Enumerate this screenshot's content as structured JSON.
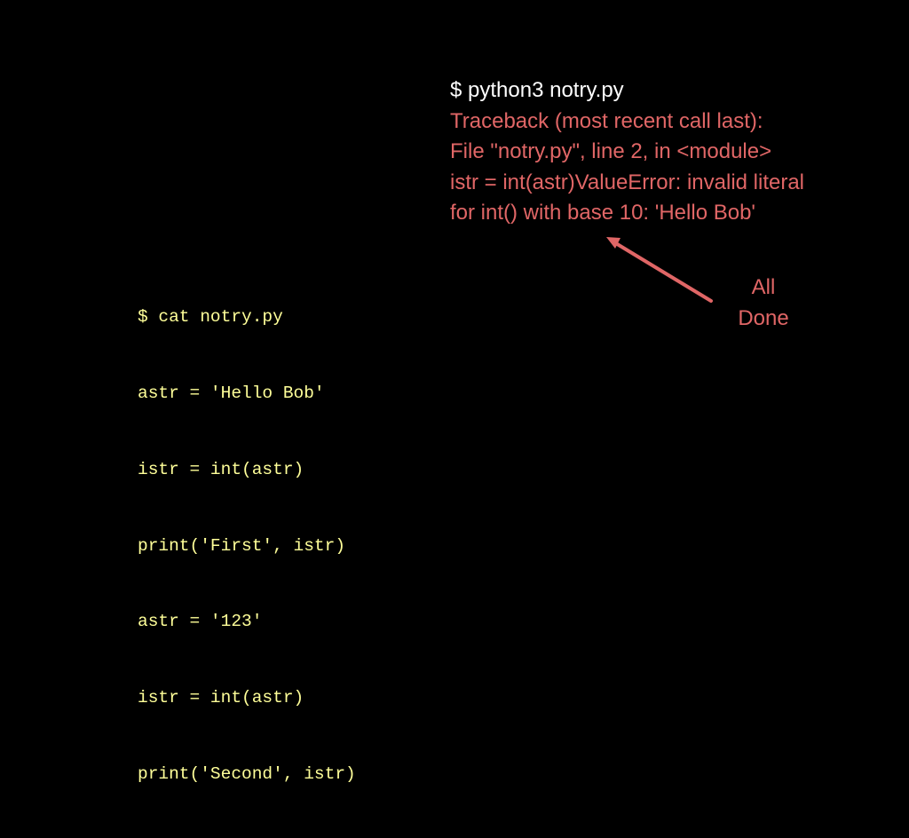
{
  "colors": {
    "background": "#000000",
    "command": "#ffffff",
    "error": "#e06666",
    "code": "#ffff99",
    "arrow": "#e06666"
  },
  "terminal_output": {
    "command": "$ python3 notry.py",
    "error_lines": [
      "Traceback (most recent call last):",
      "File \"notry.py\", line 2, in <module>",
      "istr = int(astr)ValueError: invalid literal",
      "for int() with base 10: 'Hello Bob'"
    ]
  },
  "code_listing": {
    "lines": [
      "$ cat notry.py",
      "astr = 'Hello Bob'",
      "istr = int(astr)",
      "print('First', istr)",
      "astr = '123'",
      "istr = int(astr)",
      "print('Second', istr)"
    ]
  },
  "annotation": {
    "line1": "All",
    "line2": "Done",
    "arrow_icon": "arrow-up-left-icon"
  }
}
